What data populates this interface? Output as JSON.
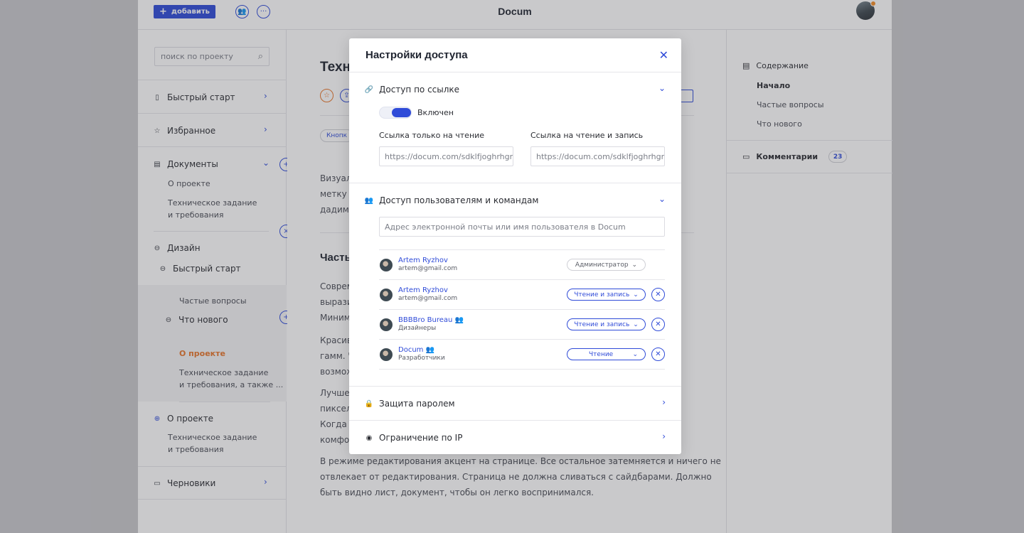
{
  "header": {
    "add_label": "добавить",
    "title": "Docum"
  },
  "sidebar": {
    "search_placeholder": "поиск по проекту",
    "quick_start": "Быстрый старт",
    "favorites": "Избранное",
    "documents": "Документы",
    "doc_about": "О проекте",
    "doc_spec": "Техническое задание\nи требования",
    "design": "Дизайн",
    "design_quick": "Быстрый старт",
    "faq": "Частые вопросы",
    "whats_new": "Что нового",
    "about_active": "О проекте",
    "spec_long": "Техническое задание\nи требования, а также ...",
    "about2": "О проекте",
    "spec2": "Техническое задание\nи требования",
    "drafts": "Черновики"
  },
  "main": {
    "title_fragment": "Техн",
    "chip_fragment": "Кнопк",
    "para1": [
      "Визуал",
      "метку п",
      "дадим с"
    ],
    "heading2": "Часть",
    "para2": [
      "Соврем",
      "вырази",
      "Минима"
    ],
    "para3": [
      "Красив",
      "гамм. Ч",
      "возмож"
    ],
    "para4": [
      "Лучше с",
      "пиксел",
      "Когда в",
      "комфор"
    ],
    "para5": [
      "В режиме редактирования акцент на странице. Все остальное затемняется и ничего не",
      "отвлекает от редактирования.  Страница не должна сливаться с сайдбарами. Должно",
      "быть видно лист, документ, чтобы он легко воспринимался."
    ]
  },
  "rightbar": {
    "contents": "Содержание",
    "start": "Начало",
    "faq": "Частые вопросы",
    "whats_new": "Что нового",
    "comments": "Комментарии",
    "comments_count": "23"
  },
  "modal": {
    "title": "Настройки доступа",
    "link_access": "Доступ по ссылке",
    "toggle_label": "Включен",
    "readonly_label": "Ссылка только на чтение",
    "readwrite_label": "Ссылка на чтение и запись",
    "readonly_url": "https://docum.com/sdklfjoghrhgru",
    "readwrite_url": "https://docum.com/sdklfjoghrhgru",
    "users_access": "Доступ пользователям и командам",
    "invite_placeholder": "Адрес электронной почты или имя пользователя в Docum",
    "users": [
      {
        "name": "Artem Ryzhov",
        "sub": "artem@gmail.com",
        "role": "Администратор",
        "team": false
      },
      {
        "name": "Artem Ryzhov",
        "sub": "artem@gmail.com",
        "role": "Чтение и запись",
        "team": false
      },
      {
        "name": "BBBBro Bureau",
        "sub": "Дизайнеры",
        "role": "Чтение и запись",
        "team": true
      },
      {
        "name": "Docum",
        "sub": "Разработчики",
        "role": "Чтение",
        "team": true
      }
    ],
    "password": "Защита паролем",
    "ip_limit": "Ограничение по IP"
  }
}
